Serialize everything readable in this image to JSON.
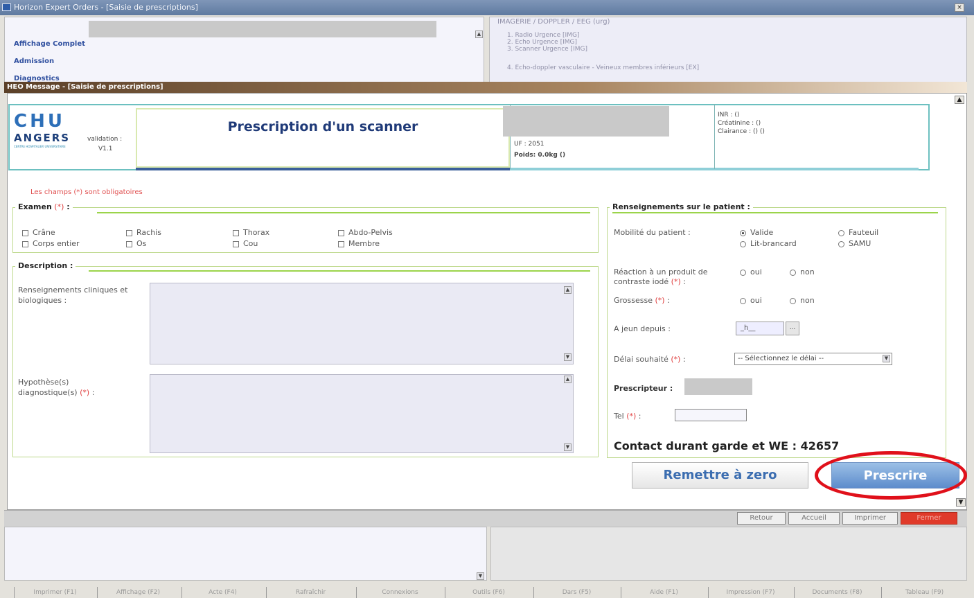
{
  "app": {
    "title": "Horizon Expert Orders  - [Saisie de prescriptions]",
    "close_glyph": "×"
  },
  "nav": {
    "links": [
      "Affichage Complet",
      "Admission",
      "Diagnostics"
    ]
  },
  "orders": {
    "header": "IMAGERIE / DOPPLER / EEG (urg)",
    "items": [
      "1. Radio Urgence [IMG]",
      "2. Echo Urgence [IMG]",
      "3. Scanner Urgence [IMG]",
      "4. Echo-doppler vasculaire - Veineux membres inférieurs [EX]"
    ]
  },
  "dialog": {
    "title": "HEO Message - [Saisie de prescriptions]",
    "logo": {
      "main": "CHU",
      "sub": "ANGERS",
      "small": "CENTRE HOSPITALIER UNIVERSITAIRE",
      "validation": "validation :",
      "version": "V1.1"
    },
    "form_title": "Prescription d'un scanner",
    "patient": {
      "uf": "UF : 2051",
      "poids": "Poids: 0.0kg ()"
    },
    "labs": {
      "inr": "INR : ()",
      "creat": "Créatinine : ()",
      "clair": "Clairance : () ()"
    },
    "required_note": "Les champs (*) sont obligatoires",
    "examen": {
      "title": "Examen",
      "req": "(*)",
      "colon": " :",
      "options": [
        "Crâne",
        "Corps entier",
        "Rachis",
        "Os",
        "Thorax",
        "Cou",
        "Abdo-Pelvis",
        "Membre"
      ]
    },
    "description": {
      "title": "Description :",
      "clinical_label": "Renseignements cliniques et biologiques :",
      "hypothesis_label": "Hypothèse(s) diagnostique(s)",
      "hypothesis_req": "(*)",
      "colon": " :"
    },
    "patient_info": {
      "title": "Renseignements sur le patient :",
      "mobility_label": "Mobilité du patient :",
      "mobility": [
        "Valide",
        "Fauteuil",
        "Lit-brancard",
        "SAMU"
      ],
      "reaction_label": "Réaction à un produit de contraste iodé",
      "reaction_req": "(*)",
      "oui": "oui",
      "non": "non",
      "grossesse_label": "Grossesse",
      "grossesse_req": "(*)",
      "jeun_label": "A jeun depuis :",
      "jeun_value": "_h__",
      "jeun_btn": "...",
      "delai_label": "Délai souhaité",
      "delai_req": "(*)",
      "delai_value": "-- Sélectionnez le délai --",
      "prescripteur_label": "Prescripteur :",
      "tel_label": "Tel",
      "tel_req": "(*)",
      "contact": "Contact durant garde et WE : 42657"
    },
    "buttons": {
      "reset": "Remettre à zero",
      "submit": "Prescrire"
    }
  },
  "status_buttons": [
    "Retour",
    "Accueil",
    "Imprimer",
    "Fermer"
  ],
  "footer_tabs": [
    "Imprimer (F1)",
    "Affichage (F2)",
    "Acte (F4)",
    "Rafraîchir",
    "Connexions",
    "Outils (F6)",
    "Dars (F5)",
    "Aide (F1)",
    "Impression (F7)",
    "Documents (F8)",
    "Tableau (F9)"
  ]
}
